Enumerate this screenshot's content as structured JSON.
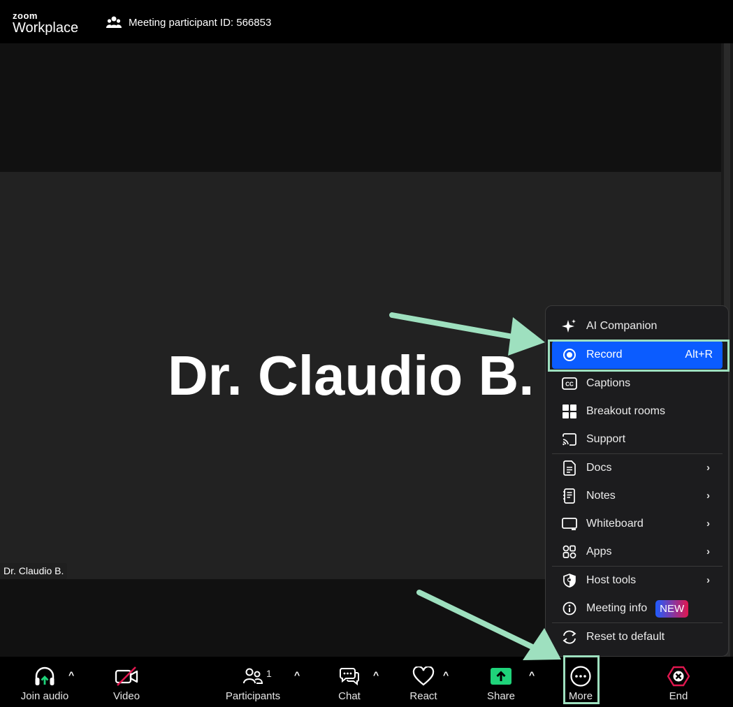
{
  "app": {
    "logo_top": "zoom",
    "logo_bottom": "Workplace",
    "participant_id_text": "Meeting participant ID: 566853"
  },
  "stage": {
    "speaker_name": "Dr. Claudio B.",
    "name_tag": "Dr. Claudio B."
  },
  "toolbar": {
    "join_audio": "Join audio",
    "video": "Video",
    "participants": "Participants",
    "participants_count": "1",
    "chat": "Chat",
    "react": "React",
    "share": "Share",
    "more": "More",
    "end": "End"
  },
  "menu": {
    "items": [
      {
        "label": "AI Companion",
        "icon": "sparkle-icon"
      },
      {
        "label": "Record",
        "icon": "record-icon",
        "shortcut": "Alt+R",
        "active": true
      },
      {
        "label": "Captions",
        "icon": "cc-icon"
      },
      {
        "label": "Breakout rooms",
        "icon": "grid-icon"
      },
      {
        "label": "Support",
        "icon": "cast-icon"
      },
      {
        "label": "Docs",
        "icon": "doc-icon",
        "submenu": true
      },
      {
        "label": "Notes",
        "icon": "notes-icon",
        "submenu": true
      },
      {
        "label": "Whiteboard",
        "icon": "whiteboard-icon",
        "submenu": true
      },
      {
        "label": "Apps",
        "icon": "apps-icon",
        "submenu": true
      },
      {
        "label": "Host tools",
        "icon": "shield-icon",
        "submenu": true
      },
      {
        "label": "Meeting info",
        "icon": "info-icon",
        "badge": "NEW"
      },
      {
        "label": "Reset to default",
        "icon": "reset-icon"
      }
    ]
  },
  "colors": {
    "accent": "#0b5cff",
    "highlight": "#9ee0bf",
    "share_green": "#1fd37a",
    "end_red": "#e0174f"
  }
}
